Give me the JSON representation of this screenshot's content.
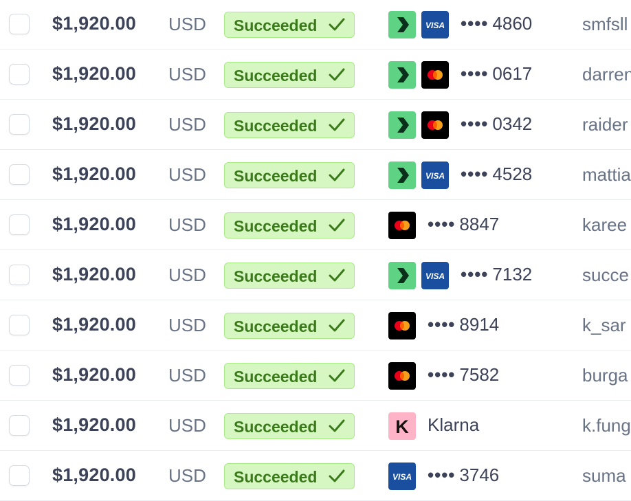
{
  "rows": [
    {
      "amount": "$1,920.00",
      "currency": "USD",
      "status": "Succeeded",
      "icons": [
        "link",
        "visa"
      ],
      "method_label": "4860",
      "masked": true,
      "customer": "smfsll"
    },
    {
      "amount": "$1,920.00",
      "currency": "USD",
      "status": "Succeeded",
      "icons": [
        "link",
        "mastercard"
      ],
      "method_label": "0617",
      "masked": true,
      "customer": "darren"
    },
    {
      "amount": "$1,920.00",
      "currency": "USD",
      "status": "Succeeded",
      "icons": [
        "link",
        "mastercard"
      ],
      "method_label": "0342",
      "masked": true,
      "customer": "raider"
    },
    {
      "amount": "$1,920.00",
      "currency": "USD",
      "status": "Succeeded",
      "icons": [
        "link",
        "visa"
      ],
      "method_label": "4528",
      "masked": true,
      "customer": "mattia"
    },
    {
      "amount": "$1,920.00",
      "currency": "USD",
      "status": "Succeeded",
      "icons": [
        "mastercard"
      ],
      "method_label": "8847",
      "masked": true,
      "customer": "karee"
    },
    {
      "amount": "$1,920.00",
      "currency": "USD",
      "status": "Succeeded",
      "icons": [
        "link",
        "visa"
      ],
      "method_label": "7132",
      "masked": true,
      "customer": "succe"
    },
    {
      "amount": "$1,920.00",
      "currency": "USD",
      "status": "Succeeded",
      "icons": [
        "mastercard"
      ],
      "method_label": "8914",
      "masked": true,
      "customer": "k_sar"
    },
    {
      "amount": "$1,920.00",
      "currency": "USD",
      "status": "Succeeded",
      "icons": [
        "mastercard"
      ],
      "method_label": "7582",
      "masked": true,
      "customer": "burga"
    },
    {
      "amount": "$1,920.00",
      "currency": "USD",
      "status": "Succeeded",
      "icons": [
        "klarna"
      ],
      "method_label": "Klarna",
      "masked": false,
      "customer": "k.fung"
    },
    {
      "amount": "$1,920.00",
      "currency": "USD",
      "status": "Succeeded",
      "icons": [
        "visa"
      ],
      "method_label": "3746",
      "masked": true,
      "customer": "suma"
    }
  ],
  "mask_dots": "••••",
  "colors": {
    "status_bg": "#d7f7c2",
    "status_border": "#a6eb84",
    "status_text": "#3b7a1a",
    "link_green": "#5fd384",
    "visa_blue": "#1a4fa0",
    "klarna_pink": "#ffb3c7"
  }
}
